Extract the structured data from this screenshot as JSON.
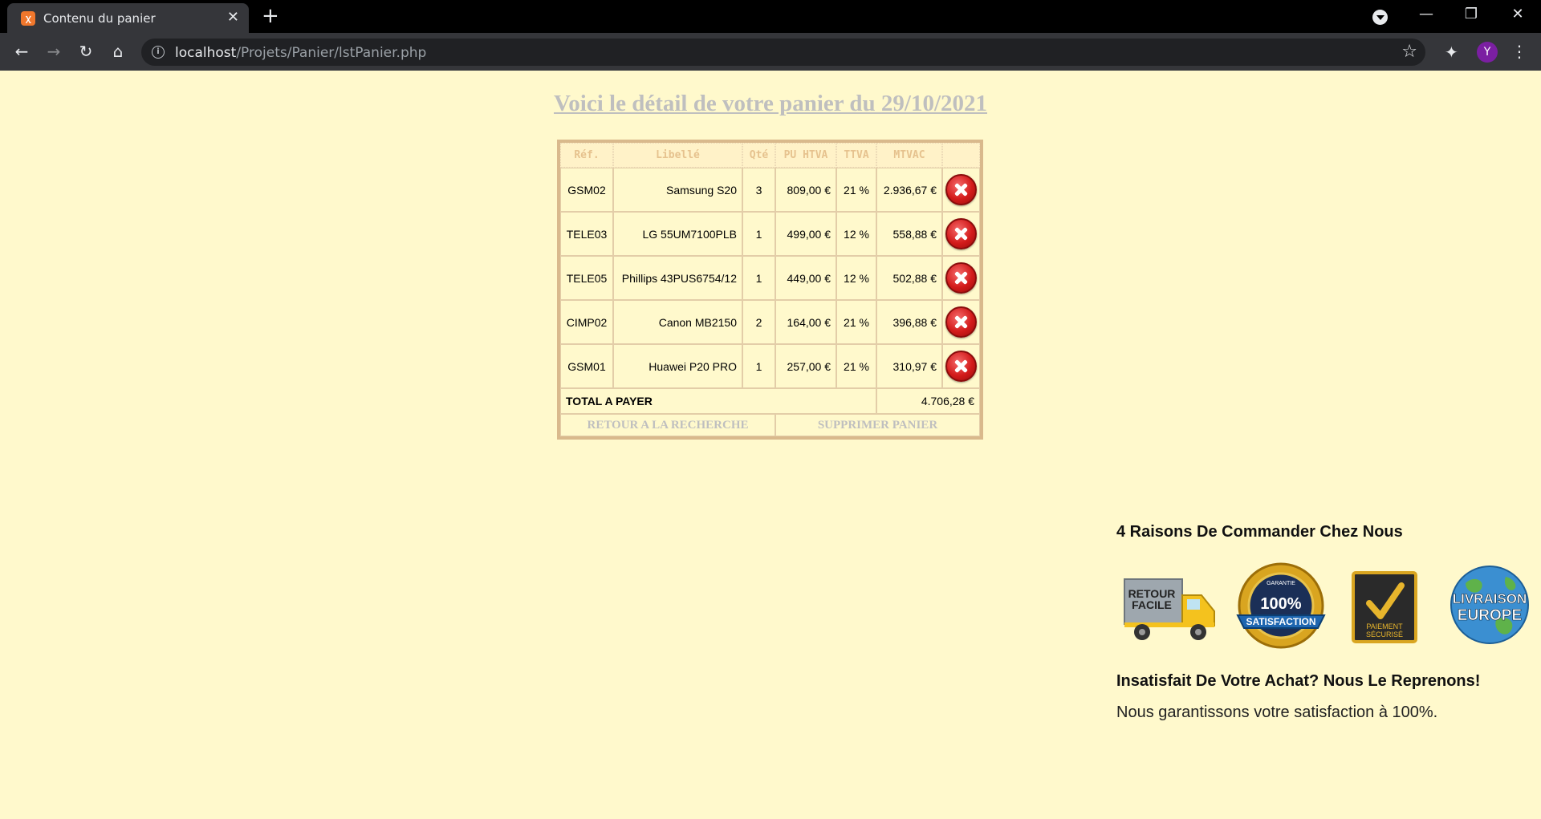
{
  "browser": {
    "tab_title": "Contenu du panier",
    "tab_close": "✕",
    "new_tab": "+",
    "url_host": "localhost",
    "url_path": "/Projets/Panier/lstPanier.php",
    "avatar_letter": "Y",
    "icons": [
      "xampp-favicon",
      "back-icon",
      "forward-icon",
      "reload-icon",
      "home-icon",
      "info-icon",
      "star-icon",
      "extensions-icon",
      "menu-icon"
    ]
  },
  "page": {
    "title": "Voici le détail de votre panier du 29/10/2021"
  },
  "cart": {
    "headers": [
      "Réf.",
      "Libellé",
      "Qté",
      "PU HTVA",
      "TTVA",
      "MTVAC",
      ""
    ],
    "rows": [
      {
        "ref": "GSM02",
        "label": "Samsung S20",
        "qty": "3",
        "pu": "809,00 €",
        "ttva": "21 %",
        "mtvac": "2.936,67 €"
      },
      {
        "ref": "TELE03",
        "label": "LG 55UM7100PLB",
        "qty": "1",
        "pu": "499,00 €",
        "ttva": "12 %",
        "mtvac": "558,88 €"
      },
      {
        "ref": "TELE05",
        "label": "Phillips 43PUS6754/12",
        "qty": "1",
        "pu": "449,00 €",
        "ttva": "12 %",
        "mtvac": "502,88 €"
      },
      {
        "ref": "CIMP02",
        "label": "Canon MB2150",
        "qty": "2",
        "pu": "164,00 €",
        "ttva": "21 %",
        "mtvac": "396,88 €"
      },
      {
        "ref": "GSM01",
        "label": "Huawei P20 PRO",
        "qty": "1",
        "pu": "257,00 €",
        "ttva": "21 %",
        "mtvac": "310,97 €"
      }
    ],
    "total_label": "TOTAL A PAYER",
    "total_value": "4.706,28 €",
    "back_link": "RETOUR A LA RECHERCHE",
    "clear_link": "SUPPRIMER PANIER"
  },
  "reasons": {
    "title": "4 Raisons De Commander Chez Nous",
    "badges": {
      "return_line1": "RETOUR",
      "return_line2": "FACILE",
      "satisfaction_top": "GARANTIE",
      "satisfaction_pct": "100%",
      "satisfaction_label": "SATISFACTION",
      "payment_line1": "PAIEMENT",
      "payment_line2": "SÉCURISÉ",
      "delivery_line1": "LIVRAISON",
      "delivery_line2": "EUROPE"
    },
    "satisfaction_title": "Insatisfait De Votre Achat? Nous Le Reprenons!",
    "satisfaction_text": "Nous garantissons votre satisfaction à 100%."
  }
}
